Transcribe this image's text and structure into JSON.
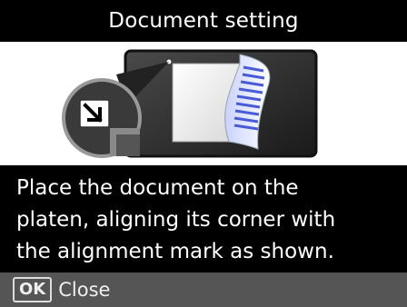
{
  "header": {
    "title": "Document setting"
  },
  "illustration": {
    "icon": "document-placement-illustration"
  },
  "message": {
    "line1": "Place the document on the",
    "line2": "platen, aligning its corner with",
    "line3": "the alignment mark as shown."
  },
  "footer": {
    "ok_key_label": "OK",
    "close_label": "Close"
  },
  "colors": {
    "background": "#000000",
    "footer_bar": "#555555",
    "text": "#ffffff",
    "illustration_bg": "#ffffff"
  }
}
